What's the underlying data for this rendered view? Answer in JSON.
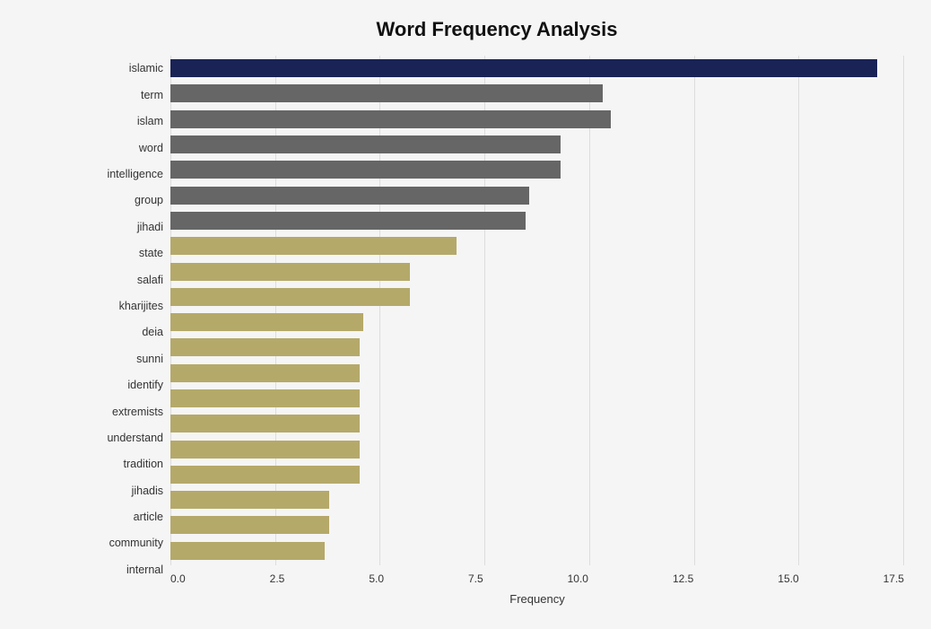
{
  "title": "Word Frequency Analysis",
  "xAxisLabel": "Frequency",
  "xTicks": [
    "0.0",
    "2.5",
    "5.0",
    "7.5",
    "10.0",
    "12.5",
    "15.0",
    "17.5"
  ],
  "maxValue": 19,
  "bars": [
    {
      "label": "islamic",
      "value": 18.3,
      "color": "#1a2355"
    },
    {
      "label": "term",
      "value": 11.2,
      "color": "#666666"
    },
    {
      "label": "islam",
      "value": 11.4,
      "color": "#666666"
    },
    {
      "label": "word",
      "value": 10.1,
      "color": "#666666"
    },
    {
      "label": "intelligence",
      "value": 10.1,
      "color": "#666666"
    },
    {
      "label": "group",
      "value": 9.3,
      "color": "#666666"
    },
    {
      "label": "jihadi",
      "value": 9.2,
      "color": "#666666"
    },
    {
      "label": "state",
      "value": 7.4,
      "color": "#b5a96a"
    },
    {
      "label": "salafi",
      "value": 6.2,
      "color": "#b5a96a"
    },
    {
      "label": "kharijites",
      "value": 6.2,
      "color": "#b5a96a"
    },
    {
      "label": "deia",
      "value": 5.0,
      "color": "#b5a96a"
    },
    {
      "label": "sunni",
      "value": 4.9,
      "color": "#b5a96a"
    },
    {
      "label": "identify",
      "value": 4.9,
      "color": "#b5a96a"
    },
    {
      "label": "extremists",
      "value": 4.9,
      "color": "#b5a96a"
    },
    {
      "label": "understand",
      "value": 4.9,
      "color": "#b5a96a"
    },
    {
      "label": "tradition",
      "value": 4.9,
      "color": "#b5a96a"
    },
    {
      "label": "jihadis",
      "value": 4.9,
      "color": "#b5a96a"
    },
    {
      "label": "article",
      "value": 4.1,
      "color": "#b5a96a"
    },
    {
      "label": "community",
      "value": 4.1,
      "color": "#b5a96a"
    },
    {
      "label": "internal",
      "value": 4.0,
      "color": "#b5a96a"
    }
  ]
}
